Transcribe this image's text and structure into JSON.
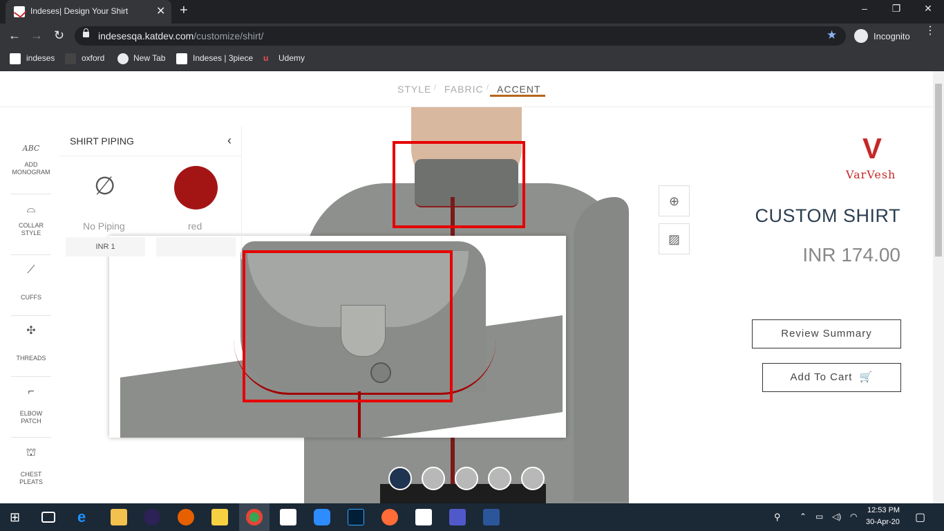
{
  "browser": {
    "tab_title": "Indeses| Design Your Shirt",
    "url_host": "indesesqa.katdev.com",
    "url_path": "/customize/shirt/",
    "profile_label": "Incognito",
    "bookmarks": [
      "indeses",
      "oxford",
      "New Tab",
      "Indeses | 3piece",
      "Udemy"
    ]
  },
  "steps": {
    "style": "STYLE",
    "fabric": "FABRIC",
    "accent": "ACCENT",
    "separator": "/"
  },
  "sidebar": {
    "items": [
      {
        "label": "ADD MONOGRAM",
        "icon": "monogram-icon"
      },
      {
        "label": "COLLAR STYLE",
        "icon": "collar-icon"
      },
      {
        "label": "CUFFS",
        "icon": "cuffs-icon"
      },
      {
        "label": "THREADS",
        "icon": "threads-icon"
      },
      {
        "label": "ELBOW PATCH",
        "icon": "elbow-patch-icon"
      },
      {
        "label": "CHEST PLEATS",
        "icon": "chest-pleats-icon"
      }
    ]
  },
  "piping_panel": {
    "title": "SHIRT PIPING",
    "options": [
      {
        "label": "No Piping",
        "price": "INR 1"
      },
      {
        "label": "red",
        "price": "",
        "color": "#a31515"
      }
    ]
  },
  "product": {
    "brand": "VarVesh",
    "title": "CUSTOM SHIRT",
    "price": "INR 174.00",
    "review_button": "Review Summary",
    "cart_button": "Add To Cart"
  },
  "swatch_colors": [
    "#1e3450",
    "#b8b8b8",
    "#b8b8b8",
    "#b8b8b8",
    "#b8b8b8"
  ],
  "accent_color": "#b5651d",
  "highlight_color": "#e60000",
  "taskbar": {
    "time": "12:53 PM",
    "date": "30-Apr-20"
  }
}
